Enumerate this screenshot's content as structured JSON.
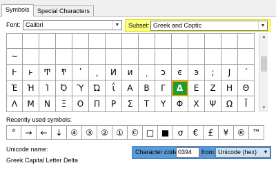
{
  "tabs": [
    {
      "label": "Symbols"
    },
    {
      "label": "Special Characters"
    }
  ],
  "font": {
    "label": "Font:",
    "value": "Calibri"
  },
  "subset": {
    "label": "Subset:",
    "value": "Greek and Coptic",
    "highlight": "#ffff80"
  },
  "grid": {
    "rows": [
      [
        "",
        "",
        "",
        "",
        "",
        "",
        "",
        "",
        "",
        "",
        "",
        "",
        "",
        "",
        ""
      ],
      [
        "~",
        "",
        "",
        "",
        "",
        "",
        "",
        "",
        "",
        "",
        "",
        "",
        "",
        "",
        ""
      ],
      [
        "Ͱ",
        "ͱ",
        "Ͳ",
        "ͳ",
        "ʹ",
        "͵",
        "Ͷ",
        "ͷ",
        "ͺ",
        "ͻ",
        "ͼ",
        "ͽ",
        ";",
        "Ϳ",
        "΄"
      ],
      [
        "Έ",
        "Ή",
        "Ί",
        "Ό",
        "Ύ",
        "Ώ",
        "ΐ",
        "Α",
        "Β",
        "Γ",
        "Δ",
        "Ε",
        "Ζ",
        "Η",
        "Θ"
      ],
      [
        "Λ",
        "Μ",
        "Ν",
        "Ξ",
        "Ο",
        "Π",
        "Ρ",
        "Σ",
        "Τ",
        "Υ",
        "Φ",
        "Χ",
        "Ψ",
        "Ω",
        "Ϊ"
      ]
    ],
    "selected": "Δ",
    "selected_color": "#1e9c37"
  },
  "recent": {
    "label": "Recently used symbols:",
    "symbols": [
      "°",
      "→",
      "←",
      "↓",
      "④",
      "③",
      "②",
      "①",
      "©",
      "□",
      "■",
      "σ",
      "€",
      "£",
      "¥",
      "®",
      "™"
    ]
  },
  "unicode": {
    "label": "Unicode name:",
    "name": "Greek Capital Letter Delta"
  },
  "charcode": {
    "label": "Character code:",
    "value": "0394",
    "from_label": "from:",
    "from_value": "Unicode (hex)"
  }
}
